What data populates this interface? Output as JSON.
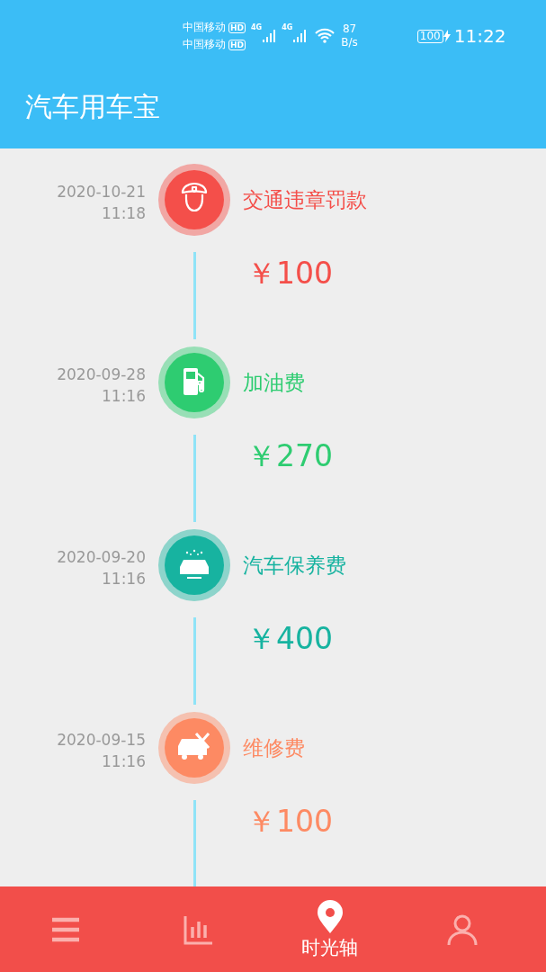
{
  "status_bar": {
    "carriers": [
      {
        "name": "中国移动",
        "badge": "HD"
      },
      {
        "name": "中国移动",
        "badge": "HD"
      }
    ],
    "network": [
      "4G",
      "4G"
    ],
    "speed_value": "87",
    "speed_unit": "B/s",
    "battery": "100",
    "charging": true,
    "time": "11:22"
  },
  "app_bar": {
    "title": "汽车用车宝"
  },
  "entries": [
    {
      "date": "2020-10-21",
      "time": "11:18",
      "kind": "police",
      "title": "交通违章罚款",
      "amount": "￥100",
      "color": "#f44f4a"
    },
    {
      "date": "2020-09-28",
      "time": "11:16",
      "kind": "fuel",
      "title": "加油费",
      "amount": "￥270",
      "color": "#2ecc71"
    },
    {
      "date": "2020-09-20",
      "time": "11:16",
      "kind": "wash",
      "title": "汽车保养费",
      "amount": "￥400",
      "color": "#17b3a0"
    },
    {
      "date": "2020-09-15",
      "time": "11:16",
      "kind": "repair",
      "title": "维修费",
      "amount": "￥100",
      "color": "#fd8a63"
    }
  ],
  "bottom_nav": [
    {
      "kind": "menu",
      "selected": false
    },
    {
      "kind": "chart",
      "selected": false
    },
    {
      "kind": "pin",
      "selected": true,
      "label": "时光轴"
    },
    {
      "kind": "person",
      "selected": false
    }
  ]
}
